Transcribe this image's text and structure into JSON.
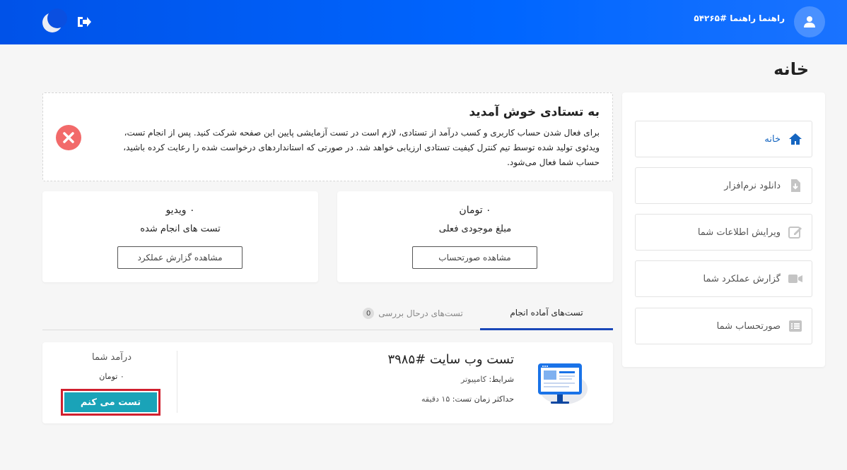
{
  "header": {
    "user_name": "راهنما راهنما #۵۴۲۶۵",
    "brand_color": "#0066ff"
  },
  "page": {
    "title": "خانه"
  },
  "sidebar": {
    "items": [
      {
        "label": "خانه",
        "icon": "home-icon",
        "active": true
      },
      {
        "label": "دانلود نرم‌افزار",
        "icon": "download-file-icon",
        "active": false
      },
      {
        "label": "ویرایش اطلاعات شما",
        "icon": "edit-icon",
        "active": false
      },
      {
        "label": "گزارش عملکرد شما",
        "icon": "video-camera-icon",
        "active": false
      },
      {
        "label": "صورتحساب شما",
        "icon": "list-icon",
        "active": false
      }
    ]
  },
  "welcome": {
    "title": "به تستادی خوش آمدید",
    "body": "برای فعال شدن حساب کاربری و کسب درآمد از تستادی، لازم است در تست آزمایشی پایین این صفحه شرکت کنید. پس از انجام تست، ویدئوی تولید شده توسط تیم کنترل کیفیت تستادی ارزیابی خواهد شد. در صورتی که استانداردهای درخواست شده را رعایت کرده باشید، حساب شما فعال می‌شود."
  },
  "stats": {
    "balance": {
      "value": "۰ تومان",
      "label": "مبلغ موجودی فعلی",
      "button": "مشاهده صورتحساب"
    },
    "videos": {
      "value": "۰ ویدیو",
      "label": "تست های انجام شده",
      "button": "مشاهده گزارش عملکرد"
    }
  },
  "tabs": {
    "ready": "تست‌های آماده انجام",
    "review": "تست‌های درحال بررسی",
    "review_count": "0"
  },
  "test": {
    "title": "تست وب سایت #۳۹۸۵",
    "condition_label": "شرایط:",
    "condition_value": "کامپیوتر",
    "time_label": "حداکثر زمان تست:",
    "time_value": "۱۵ دقیقه",
    "income_label": "درآمد شما",
    "income_value": "۰ تومان",
    "button": "تست می کنم",
    "button_color": "#1aa3b8",
    "highlight_color": "#d0202e"
  }
}
